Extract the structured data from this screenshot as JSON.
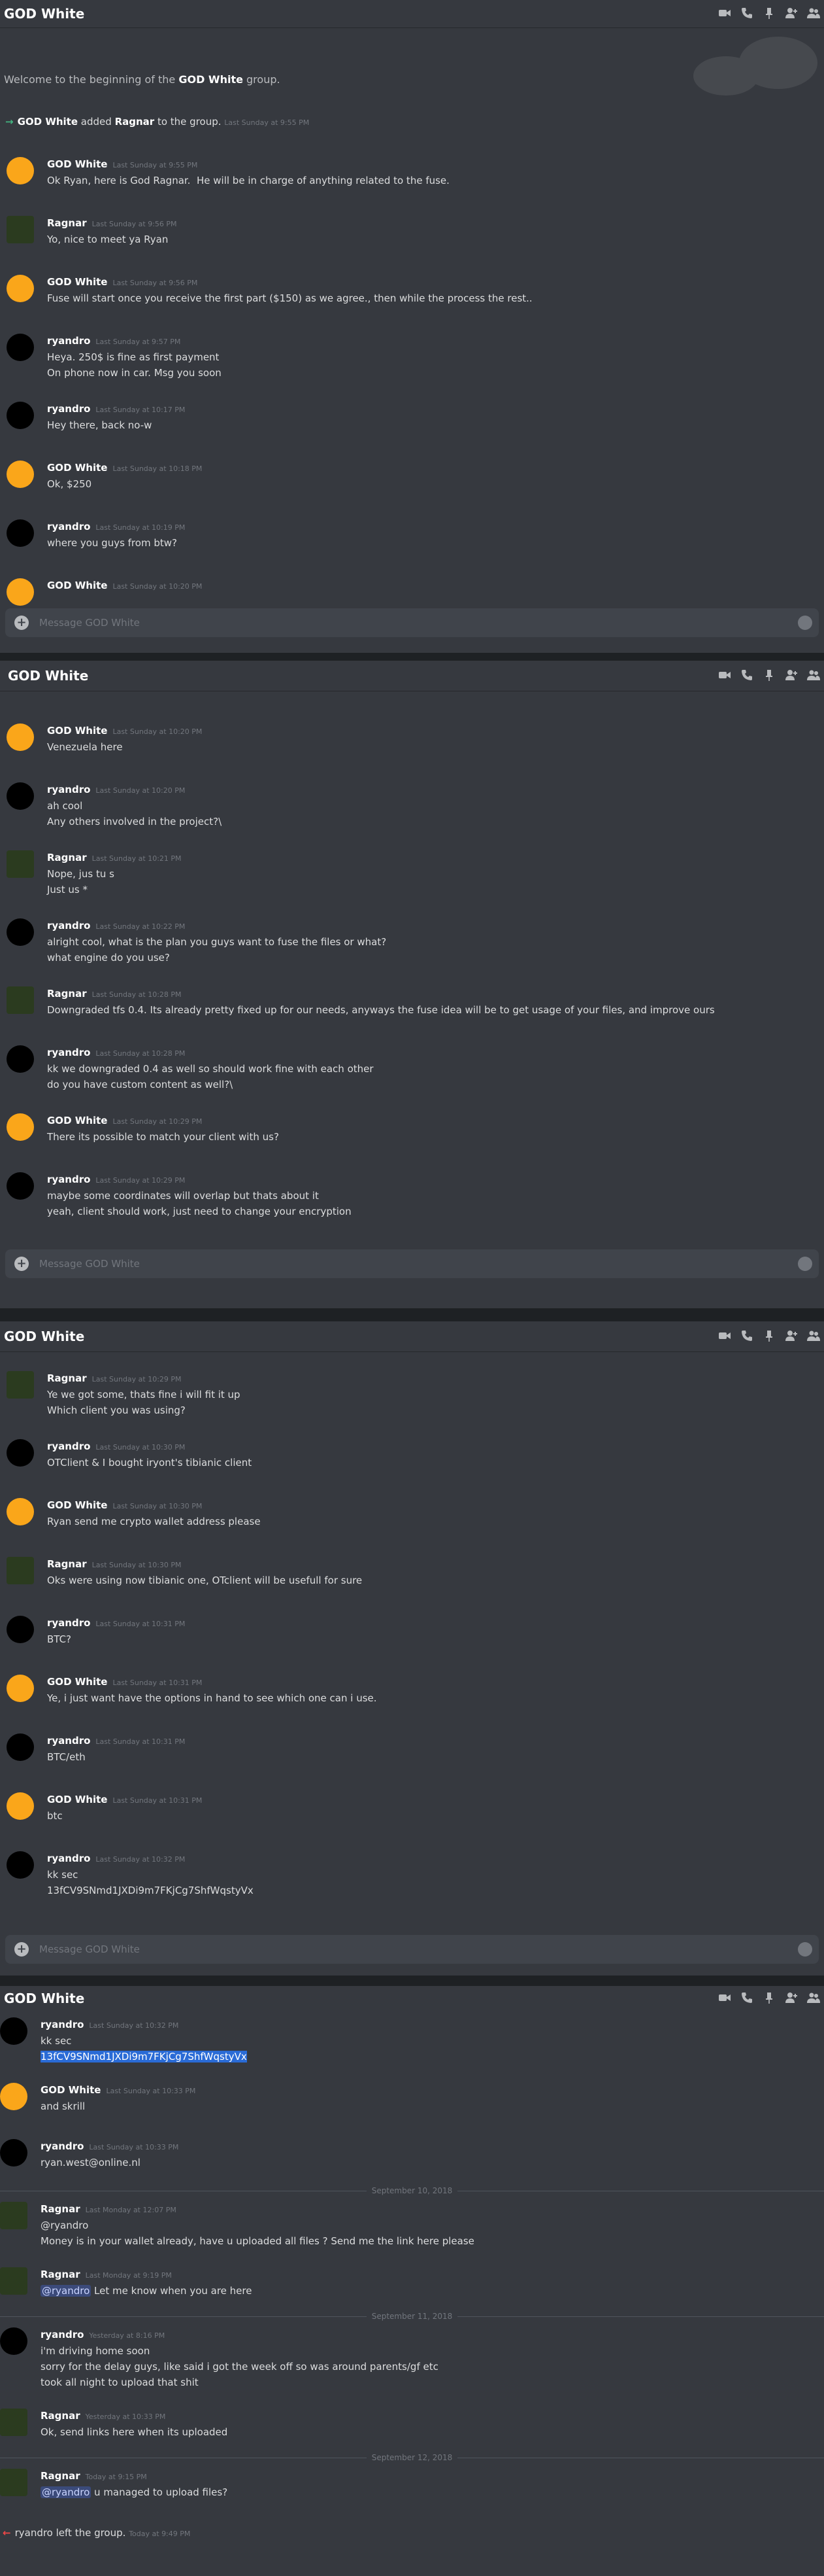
{
  "window_title": "GOD White",
  "composer_placeholder": "Message GOD White",
  "colors": {
    "accent": "#7289da",
    "online": "#43b581",
    "leave": "#f04747",
    "bg": "#36393f"
  },
  "icons": [
    "video-call-icon",
    "phone-icon",
    "pin-icon",
    "add-member-icon",
    "members-icon"
  ],
  "panel1": {
    "welcome_pre": "Welcome to the beginning of the ",
    "welcome_group": "GOD White",
    "welcome_post": " group.",
    "added": {
      "actor": "GOD White",
      "mid": " added ",
      "target": "Ragnar",
      "post": " to the group.",
      "ts": "Last Sunday at 9:55 PM"
    },
    "messages": [
      {
        "author": "GOD White",
        "ts": "Last Sunday at 9:55 PM",
        "lines": [
          "Ok Ryan, here is God Ragnar.  He will be in charge of anything related to the fuse."
        ]
      },
      {
        "author": "Ragnar",
        "ts": "Last Sunday at 9:56 PM",
        "lines": [
          "Yo, nice to meet ya Ryan"
        ]
      },
      {
        "author": "GOD White",
        "ts": "Last Sunday at 9:56 PM",
        "lines": [
          "Fuse will start once you receive the first part ($150) as we agree., then while the process the rest.."
        ]
      },
      {
        "author": "ryandro",
        "ts": "Last Sunday at 9:57 PM",
        "lines": [
          "Heya. 250$ is fine as first payment",
          "On phone now in car. Msg you soon"
        ]
      },
      {
        "author": "ryandro",
        "ts": "Last Sunday at 10:17 PM",
        "lines": [
          "Hey there, back no-w"
        ]
      },
      {
        "author": "GOD White",
        "ts": "Last Sunday at 10:18 PM",
        "lines": [
          "Ok, $250"
        ]
      },
      {
        "author": "ryandro",
        "ts": "Last Sunday at 10:19 PM",
        "lines": [
          "where you guys from btw?"
        ]
      },
      {
        "author": "GOD White",
        "ts": "Last Sunday at 10:20 PM",
        "lines": []
      }
    ]
  },
  "panel2": {
    "messages": [
      {
        "author": "GOD White",
        "ts": "Last Sunday at 10:20 PM",
        "lines": [
          "Venezuela here"
        ]
      },
      {
        "author": "ryandro",
        "ts": "Last Sunday at 10:20 PM",
        "lines": [
          "ah cool",
          "Any others involved in the project?\\"
        ]
      },
      {
        "author": "Ragnar",
        "ts": "Last Sunday at 10:21 PM",
        "lines": [
          "Nope, jus tu s",
          "Just us *"
        ]
      },
      {
        "author": "ryandro",
        "ts": "Last Sunday at 10:22 PM",
        "lines": [
          "alright cool, what is the plan you guys want to fuse the files or what?",
          "what engine do you use?"
        ]
      },
      {
        "author": "Ragnar",
        "ts": "Last Sunday at 10:28 PM",
        "lines": [
          "Downgraded tfs 0.4. Its already pretty fixed up for our needs, anyways the fuse idea will be to get usage of your files, and improve ours"
        ]
      },
      {
        "author": "ryandro",
        "ts": "Last Sunday at 10:28 PM",
        "lines": [
          "kk we downgraded 0.4 as well so should work fine with each other",
          "do you have custom content as well?\\"
        ]
      },
      {
        "author": "GOD White",
        "ts": "Last Sunday at 10:29 PM",
        "lines": [
          "There its possible to match your client with us?"
        ]
      },
      {
        "author": "ryandro",
        "ts": "Last Sunday at 10:29 PM",
        "lines": [
          "maybe some coordinates will overlap but thats about it",
          "yeah, client should work, just need to change your encryption"
        ]
      }
    ]
  },
  "panel3": {
    "messages": [
      {
        "author": "Ragnar",
        "ts": "Last Sunday at 10:29 PM",
        "lines": [
          "Ye we got some, thats fine i will fit it up",
          "Which client you was using?"
        ]
      },
      {
        "author": "ryandro",
        "ts": "Last Sunday at 10:30 PM",
        "lines": [
          "OTClient & I bought iryont's tibianic client"
        ]
      },
      {
        "author": "GOD White",
        "ts": "Last Sunday at 10:30 PM",
        "lines": [
          "Ryan send me crypto wallet address please"
        ]
      },
      {
        "author": "Ragnar",
        "ts": "Last Sunday at 10:30 PM",
        "lines": [
          "Oks were using now tibianic one, OTclient will be usefull for sure"
        ]
      },
      {
        "author": "ryandro",
        "ts": "Last Sunday at 10:31 PM",
        "lines": [
          "BTC?"
        ]
      },
      {
        "author": "GOD White",
        "ts": "Last Sunday at 10:31 PM",
        "lines": [
          "Ye, i just want have the options in hand to see which one can i use."
        ]
      },
      {
        "author": "ryandro",
        "ts": "Last Sunday at 10:31 PM",
        "lines": [
          "BTC/eth"
        ]
      },
      {
        "author": "GOD White",
        "ts": "Last Sunday at 10:31 PM",
        "lines": [
          "btc"
        ]
      },
      {
        "author": "ryandro",
        "ts": "Last Sunday at 10:32 PM",
        "lines": [
          "kk sec",
          "13fCV9SNmd1JXDi9m7FKjCg7ShfWqstyVx"
        ]
      }
    ]
  },
  "panel4": {
    "m1": {
      "author": "ryandro",
      "ts": "Last Sunday at 10:32 PM",
      "l1": "kk sec",
      "l2": "13fCV9SNmd1JXDi9m7FKjCg7ShfWqstyVx"
    },
    "m2": {
      "author": "GOD White",
      "ts": "Last Sunday at 10:33 PM",
      "l1": "and skrill"
    },
    "m3": {
      "author": "ryandro",
      "ts": "Last Sunday at 10:33 PM",
      "l1": "ryan.west@online.nl"
    },
    "d1": "September 10, 2018",
    "m4": {
      "author": "Ragnar",
      "ts": "Last Monday at 12:07 PM",
      "l1": "@ryandro",
      "l2": "Money is in your wallet already, have u uploaded all files ? Send me the link here please"
    },
    "m5": {
      "author": "Ragnar",
      "ts": "Last Monday at 9:19 PM",
      "mention": "@ryandro",
      "rest": " Let me know when you are here"
    },
    "d2": "September 11, 2018",
    "m6": {
      "author": "ryandro",
      "ts": "Yesterday at 8:16 PM",
      "l1": "i'm driving home soon",
      "l2": "sorry for the delay guys, like said i got the week off so was around parents/gf etc",
      "l3": "took all night to upload that shit"
    },
    "m7": {
      "author": "Ragnar",
      "ts": "Yesterday at 10:33 PM",
      "l1": "Ok, send links here when its uploaded"
    },
    "d3": "September 12, 2018",
    "m8": {
      "author": "Ragnar",
      "ts": "Today at 9:15 PM",
      "mention": "@ryandro",
      "rest": " u managed to upload files?"
    },
    "left": {
      "actor": "ryandro",
      "post": " left the group.",
      "ts": "Today at 9:49 PM"
    }
  }
}
